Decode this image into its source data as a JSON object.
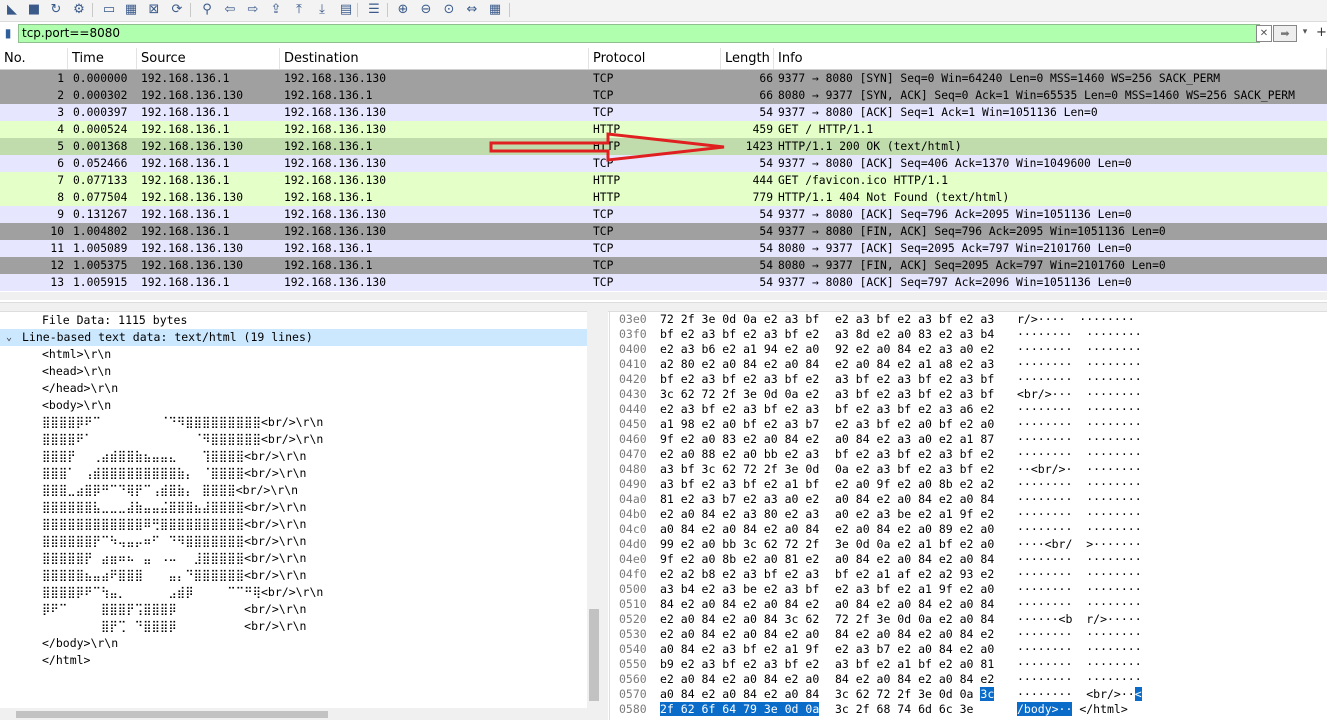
{
  "toolbar": {
    "icons": [
      "shark-fin-start-icon",
      "stop-icon",
      "restart-icon",
      "options-gear-icon",
      "open-folder-icon",
      "save-file-icon",
      "close-file-icon",
      "reload-icon",
      "find-icon",
      "back-arrow-icon",
      "forward-arrow-icon",
      "go-to-packet-icon",
      "first-packet-icon",
      "last-packet-icon",
      "autoscroll-icon",
      "colorize-icon",
      "zoom-in-icon",
      "zoom-out-icon",
      "zoom-normal-icon",
      "resize-columns-icon",
      "layout-icon"
    ]
  },
  "filter": {
    "value": "tcp.port==8080"
  },
  "packet_list": {
    "columns": [
      "No.",
      "Time",
      "Source",
      "Destination",
      "Protocol",
      "Length",
      "Info"
    ],
    "rows": [
      {
        "no": "1",
        "time": "0.000000",
        "src": "192.168.136.1",
        "dst": "192.168.136.130",
        "proto": "TCP",
        "len": "66",
        "info": "9377 → 8080 [SYN] Seq=0 Win=64240 Len=0 MSS=1460 WS=256 SACK_PERM",
        "style": "tcp-dark"
      },
      {
        "no": "2",
        "time": "0.000302",
        "src": "192.168.136.130",
        "dst": "192.168.136.1",
        "proto": "TCP",
        "len": "66",
        "info": "8080 → 9377 [SYN, ACK] Seq=0 Ack=1 Win=65535 Len=0 MSS=1460 WS=256 SACK_PERM",
        "style": "tcp-dark"
      },
      {
        "no": "3",
        "time": "0.000397",
        "src": "192.168.136.1",
        "dst": "192.168.136.130",
        "proto": "TCP",
        "len": "54",
        "info": "9377 → 8080 [ACK] Seq=1 Ack=1 Win=1051136 Len=0",
        "style": "tcp-light"
      },
      {
        "no": "4",
        "time": "0.000524",
        "src": "192.168.136.1",
        "dst": "192.168.136.130",
        "proto": "HTTP",
        "len": "459",
        "info": "GET / HTTP/1.1",
        "style": "http"
      },
      {
        "no": "5",
        "time": "0.001368",
        "src": "192.168.136.130",
        "dst": "192.168.136.1",
        "proto": "HTTP",
        "len": "1423",
        "info": "HTTP/1.1 200 OK  (text/html)",
        "style": "http-sel"
      },
      {
        "no": "6",
        "time": "0.052466",
        "src": "192.168.136.1",
        "dst": "192.168.136.130",
        "proto": "TCP",
        "len": "54",
        "info": "9377 → 8080 [ACK] Seq=406 Ack=1370 Win=1049600 Len=0",
        "style": "tcp-light"
      },
      {
        "no": "7",
        "time": "0.077133",
        "src": "192.168.136.1",
        "dst": "192.168.136.130",
        "proto": "HTTP",
        "len": "444",
        "info": "GET /favicon.ico HTTP/1.1",
        "style": "http"
      },
      {
        "no": "8",
        "time": "0.077504",
        "src": "192.168.136.130",
        "dst": "192.168.136.1",
        "proto": "HTTP",
        "len": "779",
        "info": "HTTP/1.1 404 Not Found  (text/html)",
        "style": "http"
      },
      {
        "no": "9",
        "time": "0.131267",
        "src": "192.168.136.1",
        "dst": "192.168.136.130",
        "proto": "TCP",
        "len": "54",
        "info": "9377 → 8080 [ACK] Seq=796 Ack=2095 Win=1051136 Len=0",
        "style": "tcp-light"
      },
      {
        "no": "10",
        "time": "1.004802",
        "src": "192.168.136.1",
        "dst": "192.168.136.130",
        "proto": "TCP",
        "len": "54",
        "info": "9377 → 8080 [FIN, ACK] Seq=796 Ack=2095 Win=1051136 Len=0",
        "style": "tcp-dark"
      },
      {
        "no": "11",
        "time": "1.005089",
        "src": "192.168.136.130",
        "dst": "192.168.136.1",
        "proto": "TCP",
        "len": "54",
        "info": "8080 → 9377 [ACK] Seq=2095 Ack=797 Win=2101760 Len=0",
        "style": "tcp-light"
      },
      {
        "no": "12",
        "time": "1.005375",
        "src": "192.168.136.130",
        "dst": "192.168.136.1",
        "proto": "TCP",
        "len": "54",
        "info": "8080 → 9377 [FIN, ACK] Seq=2095 Ack=797 Win=2101760 Len=0",
        "style": "tcp-dark"
      },
      {
        "no": "13",
        "time": "1.005915",
        "src": "192.168.136.1",
        "dst": "192.168.136.130",
        "proto": "TCP",
        "len": "54",
        "info": "9377 → 8080 [ACK] Seq=797 Ack=2096 Win=1051136 Len=0",
        "style": "tcp-light"
      }
    ]
  },
  "detail": {
    "lines": [
      {
        "text": "File Data: 1115 bytes",
        "indent": 42
      },
      {
        "text": "Line-based text data: text/html (19 lines)",
        "indent": 22,
        "selected": true,
        "toggle": "⌄"
      },
      {
        "text": "<html>\\r\\n",
        "indent": 42
      },
      {
        "text": "<head>\\r\\n",
        "indent": 42
      },
      {
        "text": "</head>\\r\\n",
        "indent": 42
      },
      {
        "text": "<body>\\r\\n",
        "indent": 42
      },
      {
        "text": "⣿⣿⣿⣿⡿⠟⠉⠀⠀⠀⠀⠀⠀⠀⠈⠙⠻⣿⣿⣿⣿⣿⣿⣿⣿⣿<br/>\\r\\n",
        "indent": 42,
        "art": true
      },
      {
        "text": "⣿⣿⣿⣿⠟⠁⠀⠀⠀⠀⠀⠀⠀⠀⠀⠀⠀⠀⠈⠻⣿⣿⣿⣿⣿⣿<br/>\\r\\n",
        "indent": 42,
        "art": true
      },
      {
        "text": "⣿⣿⣿⡟⠀⠀⢀⣴⣾⣿⣿⣷⣦⣤⣤⣄⠀⠀⠀⢹⣿⣿⣿⣿<br/>\\r\\n",
        "indent": 42,
        "art": true
      },
      {
        "text": "⣿⣿⣿⠁⠀⢠⣾⣿⣿⣿⣿⣿⣿⣿⣿⣿⣷⡄⠀⠈⣿⣿⣿⣿<br/>\\r\\n",
        "indent": 42,
        "art": true
      },
      {
        "text": "⣿⣿⣿⣀⣴⣿⡿⠛⠉⠙⢿⡟⠉⢠⣾⣿⣷⡄⠀⣿⣿⣿⣿<br/>\\r\\n",
        "indent": 42,
        "art": true
      },
      {
        "text": "⣿⣿⣿⣿⣿⣿⣧⣀⣀⣀⣼⣷⣤⣤⣬⣿⣿⣿⣦⣼⣿⣿⣿⣿<br/>\\r\\n",
        "indent": 42,
        "art": true
      },
      {
        "text": "⣿⣿⣿⣿⣿⣿⣿⣿⣿⣿⣿⣿⠿⢛⣿⣿⣿⣿⣿⣿⣿⣿⣿⣿<br/>\\r\\n",
        "indent": 42,
        "art": true
      },
      {
        "text": "⣿⣿⣿⣿⣿⣿⡟⠉⠳⢤⣤⡤⠶⠋⠀⠙⠻⣿⣿⣿⣿⣿⣿⣿<br/>\\r\\n",
        "indent": 42,
        "art": true
      },
      {
        "text": "⣿⣿⣿⣿⣿⡟⠀⣴⣶⠶⠦⠀⣤⠀⠠⠤⠀⠀⣸⣿⣿⣿⣿⣿<br/>\\r\\n",
        "indent": 42,
        "art": true
      },
      {
        "text": "⣿⣿⣿⣿⣿⣦⣤⣴⠟⣿⣿⣿⠀⠀⠀⣤⡄⠙⣿⣿⣿⣿⣿⣿<br/>\\r\\n",
        "indent": 42,
        "art": true
      },
      {
        "text": "⣿⣿⣿⣿⡿⠟⠉⢳⣤⡀⠀⠀⠀⠀⠀⣠⣾⡿⠀⠀⠀⠀⠉⠉⠛⢿<br/>\\r\\n",
        "indent": 42,
        "art": true
      },
      {
        "text": "⡿⠟⠉⠀⠀⠀⠀⣿⣿⣿⡟⢩⣿⣿⣿⡿⠀⠀⠀⠀⠀⠀⠀⠀<br/>\\r\\n",
        "indent": 42,
        "art": true
      },
      {
        "text": "⠀⠀⠀⠀⠀⠀⠀⣿⡟⢉⠀⠙⣿⣿⣿⡿⠀⠀⠀⠀⠀⠀⠀⠀<br/>\\r\\n",
        "indent": 42,
        "art": true
      },
      {
        "text": "</body>\\r\\n",
        "indent": 42
      },
      {
        "text": "</html>",
        "indent": 42
      }
    ]
  },
  "bytes": {
    "lines": [
      {
        "off": "03e0",
        "h1": "72 2f 3e 0d 0a e2 a3 bf",
        "h2": "e2 a3 bf e2 a3 bf e2 a3",
        "asc": "r/>····  ········"
      },
      {
        "off": "03f0",
        "h1": "bf e2 a3 bf e2 a3 bf e2",
        "h2": "a3 8d e2 a0 83 e2 a3 b4",
        "asc": "········  ········"
      },
      {
        "off": "0400",
        "h1": "e2 a3 b6 e2 a1 94 e2 a0",
        "h2": "92 e2 a0 84 e2 a3 a0 e2",
        "asc": "········  ········"
      },
      {
        "off": "0410",
        "h1": "a2 80 e2 a0 84 e2 a0 84",
        "h2": "e2 a0 84 e2 a1 a8 e2 a3",
        "asc": "········  ········"
      },
      {
        "off": "0420",
        "h1": "bf e2 a3 bf e2 a3 bf e2",
        "h2": "a3 bf e2 a3 bf e2 a3 bf",
        "asc": "········  ········"
      },
      {
        "off": "0430",
        "h1": "3c 62 72 2f 3e 0d 0a e2",
        "h2": "a3 bf e2 a3 bf e2 a3 bf",
        "asc": "<br/>···  ········"
      },
      {
        "off": "0440",
        "h1": "e2 a3 bf e2 a3 bf e2 a3",
        "h2": "bf e2 a3 bf e2 a3 a6 e2",
        "asc": "········  ········"
      },
      {
        "off": "0450",
        "h1": "a1 98 e2 a0 bf e2 a3 b7",
        "h2": "e2 a3 bf e2 a0 bf e2 a0",
        "asc": "········  ········"
      },
      {
        "off": "0460",
        "h1": "9f e2 a0 83 e2 a0 84 e2",
        "h2": "a0 84 e2 a3 a0 e2 a1 87",
        "asc": "········  ········"
      },
      {
        "off": "0470",
        "h1": "e2 a0 88 e2 a0 bb e2 a3",
        "h2": "bf e2 a3 bf e2 a3 bf e2",
        "asc": "········  ········"
      },
      {
        "off": "0480",
        "h1": "a3 bf 3c 62 72 2f 3e 0d",
        "h2": "0a e2 a3 bf e2 a3 bf e2",
        "asc": "··<br/>·  ········"
      },
      {
        "off": "0490",
        "h1": "a3 bf e2 a3 bf e2 a1 bf",
        "h2": "e2 a0 9f e2 a0 8b e2 a2",
        "asc": "········  ········"
      },
      {
        "off": "04a0",
        "h1": "81 e2 a3 b7 e2 a3 a0 e2",
        "h2": "a0 84 e2 a0 84 e2 a0 84",
        "asc": "········  ········"
      },
      {
        "off": "04b0",
        "h1": "e2 a0 84 e2 a3 80 e2 a3",
        "h2": "a0 e2 a3 be e2 a1 9f e2",
        "asc": "········  ········"
      },
      {
        "off": "04c0",
        "h1": "a0 84 e2 a0 84 e2 a0 84",
        "h2": "e2 a0 84 e2 a0 89 e2 a0",
        "asc": "········  ········"
      },
      {
        "off": "04d0",
        "h1": "99 e2 a0 bb 3c 62 72 2f",
        "h2": "3e 0d 0a e2 a1 bf e2 a0",
        "asc": "····<br/  >·······"
      },
      {
        "off": "04e0",
        "h1": "9f e2 a0 8b e2 a0 81 e2",
        "h2": "a0 84 e2 a0 84 e2 a0 84",
        "asc": "········  ········"
      },
      {
        "off": "04f0",
        "h1": "e2 a2 b8 e2 a3 bf e2 a3",
        "h2": "bf e2 a1 af e2 a2 93 e2",
        "asc": "········  ········"
      },
      {
        "off": "0500",
        "h1": "a3 b4 e2 a3 be e2 a3 bf",
        "h2": "e2 a3 bf e2 a1 9f e2 a0",
        "asc": "········  ········"
      },
      {
        "off": "0510",
        "h1": "84 e2 a0 84 e2 a0 84 e2",
        "h2": "a0 84 e2 a0 84 e2 a0 84",
        "asc": "········  ········"
      },
      {
        "off": "0520",
        "h1": "e2 a0 84 e2 a0 84 3c 62",
        "h2": "72 2f 3e 0d 0a e2 a0 84",
        "asc": "······<b  r/>·····"
      },
      {
        "off": "0530",
        "h1": "e2 a0 84 e2 a0 84 e2 a0",
        "h2": "84 e2 a0 84 e2 a0 84 e2",
        "asc": "········  ········"
      },
      {
        "off": "0540",
        "h1": "a0 84 e2 a3 bf e2 a1 9f",
        "h2": "e2 a3 b7 e2 a0 84 e2 a0",
        "asc": "········  ········"
      },
      {
        "off": "0550",
        "h1": "b9 e2 a3 bf e2 a3 bf e2",
        "h2": "a3 bf e2 a1 bf e2 a0 81",
        "asc": "········  ········"
      },
      {
        "off": "0560",
        "h1": "e2 a0 84 e2 a0 84 e2 a0",
        "h2": "84 e2 a0 84 e2 a0 84 e2",
        "asc": "········  ········"
      },
      {
        "off": "0570",
        "h1": "a0 84 e2 a0 84 e2 a0 84",
        "h2": "3c 62 72 2f 3e 0d 0a ",
        "h2hl": "3c",
        "asc": "········  <br/>··",
        "aschl": "<"
      },
      {
        "off": "0580",
        "h1hl": "2f 62 6f 64 79 3e 0d 0a",
        "h2": "3c 2f 68 74 6d 6c 3e",
        "aschl2": "/body>··",
        "asc2": " </html>"
      }
    ]
  },
  "colors": {
    "filter_ok": "#afffaf",
    "tcp_light": "#e7e6ff",
    "tcp_dark": "#a0a0a0",
    "http": "#e4ffc7",
    "selection": "#cce8ff",
    "highlight": "#0a6bc9",
    "annotation_arrow": "#e02020"
  }
}
